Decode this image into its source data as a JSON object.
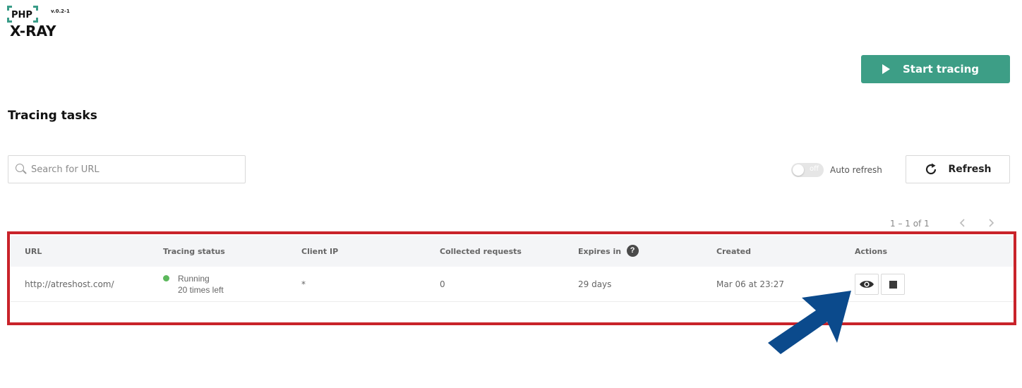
{
  "app": {
    "logo_php": "PHP",
    "logo_xray": "X-RAY",
    "version": "v.0.2-1"
  },
  "header": {
    "start_button_label": "Start tracing",
    "section_title": "Tracing tasks"
  },
  "search": {
    "placeholder": "Search for URL",
    "value": ""
  },
  "auto_refresh": {
    "label": "Auto refresh",
    "state_label": "off",
    "enabled": false
  },
  "refresh_button_label": "Refresh",
  "pagination": {
    "text": "1 – 1 of 1"
  },
  "table": {
    "columns": [
      "URL",
      "Tracing status",
      "Client IP",
      "Collected requests",
      "Expires in",
      "Created",
      "Actions"
    ],
    "expires_help": "?",
    "rows": [
      {
        "url": "http://atreshost.com/",
        "status": "Running",
        "status_detail": "20 times left",
        "client_ip": "*",
        "collected_requests": "0",
        "expires_in": "29 days",
        "created": "Mar 06 at 23:27"
      }
    ]
  },
  "colors": {
    "accent": "#3d9e86",
    "highlight": "#c9232a",
    "arrow": "#0b4a8c",
    "running": "#5cb85c"
  },
  "icons": {
    "start": "play-icon",
    "search": "search-icon",
    "refresh": "refresh-icon",
    "view": "eye-icon",
    "stop": "stop-icon",
    "help": "question-circle-icon"
  }
}
